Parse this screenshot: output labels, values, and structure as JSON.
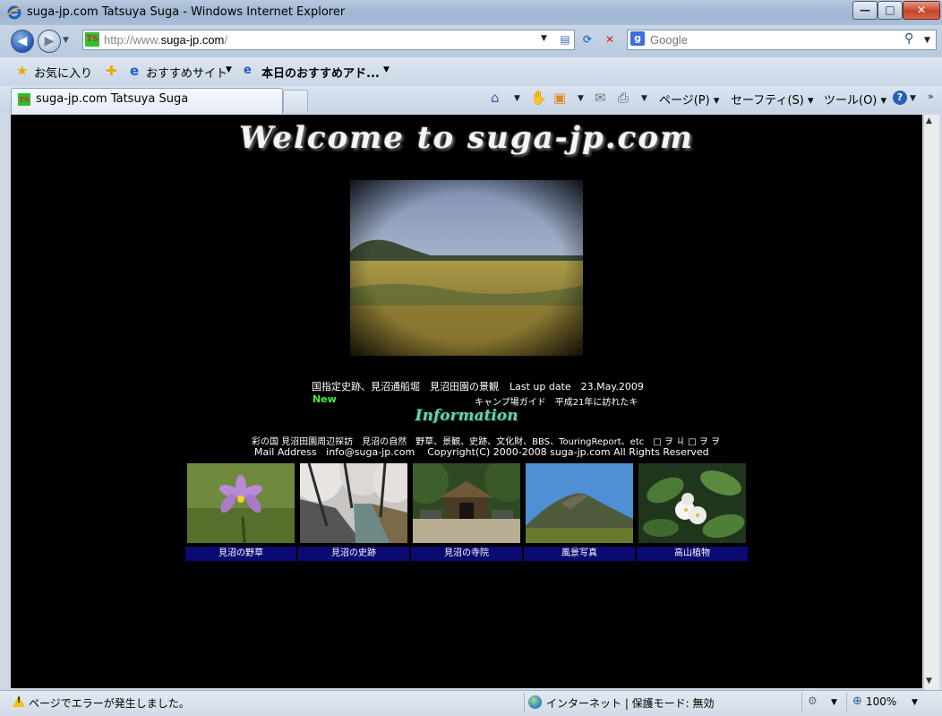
{
  "window": {
    "title": "suga-jp.com Tatsuya Suga - Windows Internet Explorer",
    "min_label": "—",
    "max_label": "□",
    "close_label": "✕"
  },
  "address_bar": {
    "url_prefix": "http://www.",
    "url_domain": "suga-jp.com",
    "url_suffix": "/",
    "favicon_text": "TS"
  },
  "search": {
    "engine": "Google"
  },
  "favorites_bar": {
    "favorites_label": "お気に入り",
    "suggested_sites_label": "おすすめサイト",
    "web_slice_label": "本日のおすすめアド..."
  },
  "tab": {
    "title": "suga-jp.com Tatsuya Suga"
  },
  "command_bar": {
    "page_label": "ページ(P)",
    "safety_label": "セーフティ(S)",
    "tools_label": "ツール(O)",
    "help_label": "?"
  },
  "page": {
    "welcome_title": "Welcome to suga-jp.com",
    "heritage_text": "国指定史跡、見沼通船堀　見沼田園の景観",
    "last_update": "Last up date　23.May.2009",
    "new_label": "New",
    "camp_text": "キャンプ場ガイド　平成21年に訪れたキ",
    "info_heading": "Information",
    "links_text": "彩の国 見沼田園周辺探訪　見沼の自然　野草、景観、史跡、文化財、BBS、TouringReport、etc　□ ヲ ㄐ □ ヲ ヲ",
    "mail_label": "Mail Address",
    "mail_address": "info@suga-jp.com",
    "copyright": "Copyright(C) 2000-2008 suga-jp.com All Rights Reserved",
    "thumbnails": [
      {
        "caption": "見沼の野草"
      },
      {
        "caption": "見沼の史跡"
      },
      {
        "caption": "見沼の寺院"
      },
      {
        "caption": "風景写真"
      },
      {
        "caption": "高山植物"
      }
    ]
  },
  "status_bar": {
    "message": "ページでエラーが発生しました。",
    "zone": "インターネット | 保護モード: 無効",
    "zoom": "100%"
  },
  "colors": {
    "page_background": "#000000",
    "caption_bar": "#0a0a72",
    "new_label": "#3ef04a",
    "info_heading": "#6ad0a8"
  }
}
